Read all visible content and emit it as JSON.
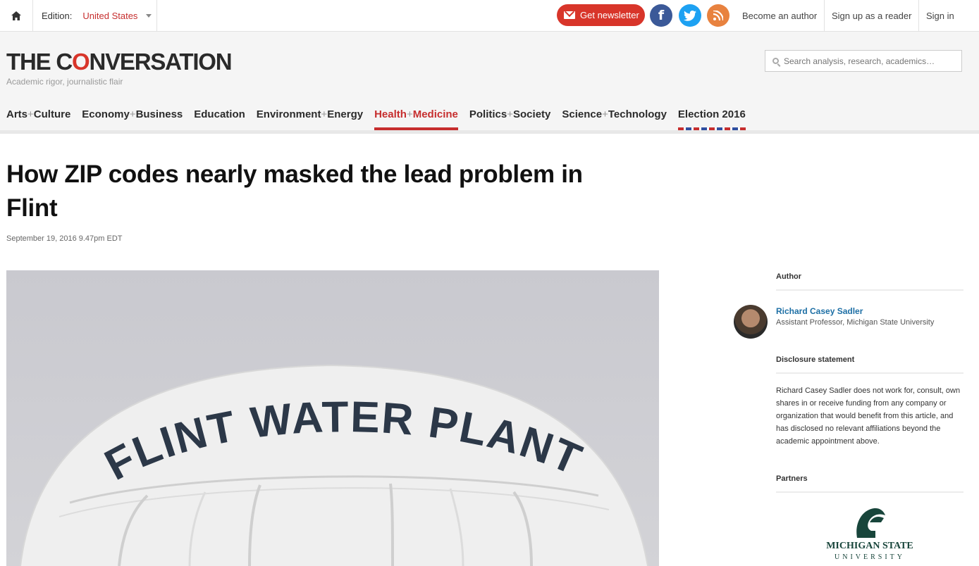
{
  "topbar": {
    "edition_label": "Edition:",
    "edition_value": "United States",
    "newsletter_label": "Get newsletter",
    "social": [
      "facebook-icon",
      "twitter-icon",
      "rss-icon"
    ],
    "links": [
      "Become an author",
      "Sign up as a reader",
      "Sign in"
    ]
  },
  "header": {
    "logo_pre": "THE C",
    "logo_o": "O",
    "logo_post": "NVERSATION",
    "tagline": "Academic rigor, journalistic flair",
    "search_placeholder": "Search analysis, research, academics…"
  },
  "nav": {
    "items": [
      {
        "a": "Arts",
        "b": "Culture"
      },
      {
        "a": "Economy",
        "b": "Business"
      },
      {
        "a": "Education",
        "b": ""
      },
      {
        "a": "Environment",
        "b": "Energy"
      },
      {
        "a": "Health",
        "b": "Medicine"
      },
      {
        "a": "Politics",
        "b": "Society"
      },
      {
        "a": "Science",
        "b": "Technology"
      },
      {
        "a": "Election 2016",
        "b": ""
      }
    ],
    "active_index": 4
  },
  "article": {
    "title": "How ZIP codes nearly masked the lead problem in Flint",
    "date": "September 19, 2016 9.47pm EDT",
    "image_text": "FLINT WATER PLANT"
  },
  "sidebar": {
    "author_heading": "Author",
    "author_name": "Richard Casey Sadler",
    "author_role": "Assistant Professor, Michigan State University",
    "disclosure_heading": "Disclosure statement",
    "disclosure_text": "Richard Casey Sadler does not work for, consult, own shares in or receive funding from any company or organization that would benefit from this article, and has disclosed no relevant affiliations beyond the academic appointment above.",
    "partners_heading": "Partners",
    "partner_line1": "MICHIGAN STATE",
    "partner_line2": "UNIVERSITY"
  },
  "colors": {
    "brand_red": "#d8352a",
    "link_blue": "#1d6fa5",
    "msu_green": "#18453b"
  }
}
